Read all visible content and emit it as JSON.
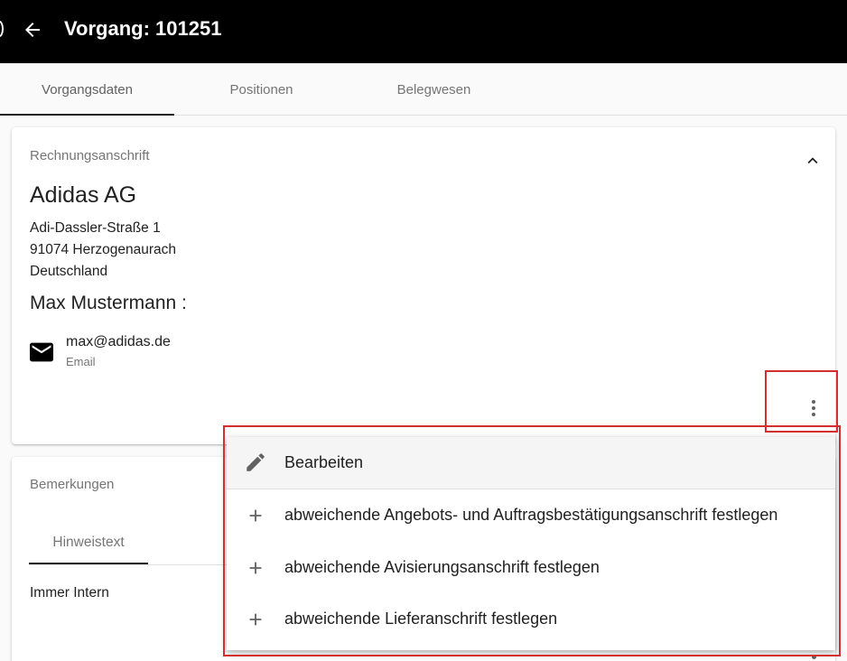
{
  "appbar": {
    "title": "Vorgang: 101251",
    "back_icon": "arrow-back-icon"
  },
  "tabs": [
    {
      "label": "Vorgangsdaten",
      "active": true
    },
    {
      "label": "Positionen",
      "active": false
    },
    {
      "label": "Belegwesen",
      "active": false
    }
  ],
  "billing_card": {
    "label": "Rechnungsanschrift",
    "collapse_icon": "chevron-up-icon",
    "company": "Adidas AG",
    "address_lines": [
      "Adi-Dassler-Straße 1",
      "91074 Herzogenaurach",
      "Deutschland"
    ],
    "contact_name": "Max Mustermann :",
    "email_value": "max@adidas.de",
    "email_label": "Email",
    "email_icon": "mail-icon",
    "more_icon": "more-vert-icon"
  },
  "remarks_card": {
    "label": "Bemerkungen",
    "tab_label": "Hinweistext",
    "text": "Immer Intern"
  },
  "menu": {
    "items": [
      {
        "label": "Bearbeiten",
        "icon": "pencil-icon"
      },
      {
        "label": "abweichende Angebots- und Auftragsbestätigungsanschrift festlegen",
        "icon": "plus-icon"
      },
      {
        "label": "abweichende Avisierungsanschrift festlegen",
        "icon": "plus-icon"
      },
      {
        "label": "abweichende Lieferanschrift festlegen",
        "icon": "plus-icon"
      }
    ]
  },
  "colors": {
    "appbar": "#000000",
    "highlight": "#d32f2f",
    "tab_indicator": "#212121",
    "menu_hover": "#f5f5f5"
  }
}
